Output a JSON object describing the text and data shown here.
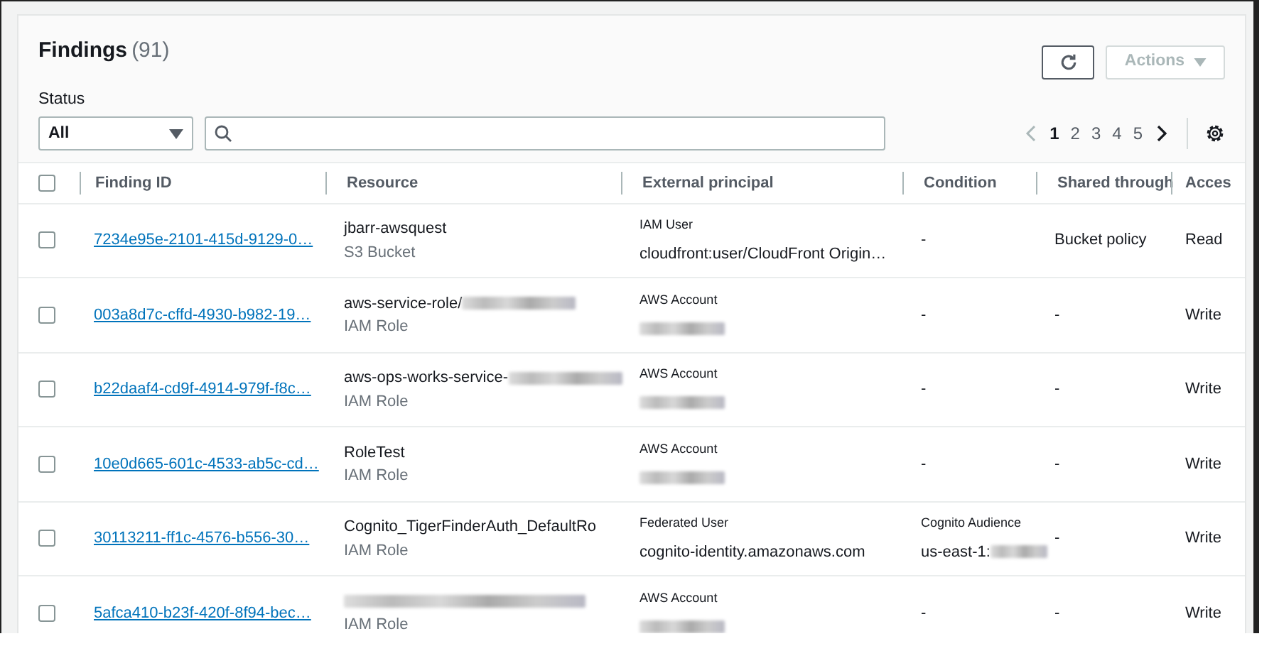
{
  "title": "Findings",
  "count": "(91)",
  "actions_button": {
    "label": "Actions",
    "disabled": true
  },
  "status_filter": {
    "label": "Status",
    "value": "All"
  },
  "pagination": {
    "pages": [
      {
        "label": "1",
        "selected": true
      },
      {
        "label": "2",
        "selected": false
      },
      {
        "label": "3",
        "selected": false
      },
      {
        "label": "4",
        "selected": false
      },
      {
        "label": "5",
        "selected": false
      }
    ]
  },
  "table": {
    "select_all": {
      "checked": false
    },
    "columns": [
      "Finding ID",
      "Resource",
      "External principal",
      "Condition",
      "Shared through",
      "Acces"
    ],
    "rows": [
      {
        "checked": false,
        "finding_id": "7234e95e-2101-415d-9129-0…",
        "resource": "jbarr-awsquest",
        "resource_redacted": false,
        "resource_type": "S3 Bucket",
        "principal_type": "IAM User",
        "principal": "cloudfront:user/CloudFront Origin…",
        "principal_redacted": false,
        "condition": "-",
        "condition_redacted": false,
        "shared_through": "Bucket policy",
        "access": "Read"
      },
      {
        "checked": false,
        "finding_id": "003a8d7c-cffd-4930-b982-19…",
        "resource": "aws-service-role/",
        "resource_redacted": true,
        "resource_type": "IAM Role",
        "principal_type": "AWS Account",
        "principal_redacted": true,
        "condition": "-",
        "condition_redacted": false,
        "shared_through": "-",
        "access": "Write"
      },
      {
        "checked": false,
        "finding_id": "b22daaf4-cd9f-4914-979f-f8c…",
        "resource": "aws-ops-works-service-",
        "resource_redacted": true,
        "resource_type": "IAM Role",
        "principal_type": "AWS Account",
        "principal_redacted": true,
        "condition": "-",
        "condition_redacted": false,
        "shared_through": "-",
        "access": "Write"
      },
      {
        "checked": false,
        "finding_id": "10e0d665-601c-4533-ab5c-cd…",
        "resource": "RoleTest",
        "resource_redacted": false,
        "resource_type": "IAM Role",
        "principal_type": "AWS Account",
        "principal_redacted": true,
        "condition": "-",
        "condition_redacted": false,
        "shared_through": "-",
        "access": "Write"
      },
      {
        "checked": false,
        "finding_id": "30113211-ff1c-4576-b556-30…",
        "resource": "Cognito_TigerFinderAuth_DefaultRo",
        "resource_redacted": false,
        "resource_type": "IAM Role",
        "principal_type": "Federated User",
        "principal": "cognito-identity.amazonaws.com",
        "principal_redacted": false,
        "condition_type": "Cognito Audience",
        "condition": "us-east-1:",
        "condition_redacted": true,
        "shared_through": "-",
        "access": "Write"
      },
      {
        "checked": false,
        "finding_id": "5afca410-b23f-420f-8f94-bec…",
        "resource_redacted": true,
        "resource_type": "IAM Role",
        "principal_type": "AWS Account",
        "principal_redacted": true,
        "condition": "-",
        "condition_redacted": false,
        "shared_through": "-",
        "access": "Write"
      }
    ]
  }
}
